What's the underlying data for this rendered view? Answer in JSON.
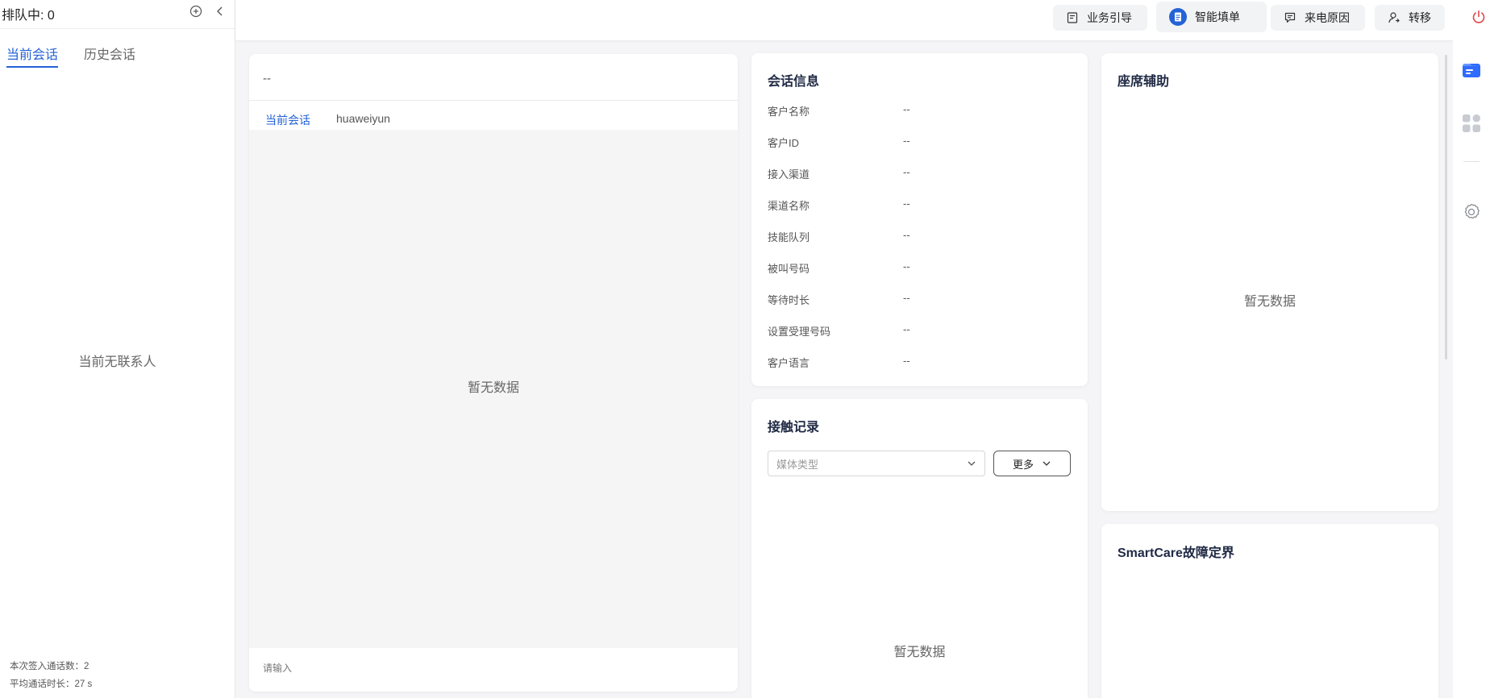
{
  "sidebar": {
    "queue_label": "排队中: 0",
    "tabs": [
      {
        "label": "当前会话",
        "active": true
      },
      {
        "label": "历史会话",
        "active": false
      }
    ],
    "empty_text": "当前无联系人",
    "stats": {
      "sign_in_calls": "本次签入通话数：2",
      "avg_call_duration": "平均通话时长：27 s"
    }
  },
  "topbar": {
    "buttons": [
      {
        "label": "业务引导",
        "icon": "guide-icon"
      },
      {
        "label": "智能填单",
        "icon": "smart-form-icon"
      },
      {
        "label": "来电原因",
        "icon": "call-reason-icon"
      },
      {
        "label": "转移",
        "icon": "transfer-icon"
      }
    ],
    "power_icon": "power-icon"
  },
  "chat": {
    "title": "--",
    "tabs": [
      {
        "label": "当前会话",
        "active": true
      },
      {
        "label": "huaweiyun",
        "active": false
      }
    ],
    "empty_text": "暂无数据",
    "input_placeholder": "请输入"
  },
  "session_info": {
    "title": "会话信息",
    "rows": [
      {
        "label": "客户名称",
        "value": "--"
      },
      {
        "label": "客户ID",
        "value": "--"
      },
      {
        "label": "接入渠道",
        "value": "--"
      },
      {
        "label": "渠道名称",
        "value": "--"
      },
      {
        "label": "技能队列",
        "value": "--"
      },
      {
        "label": "被叫号码",
        "value": "--"
      },
      {
        "label": "等待时长",
        "value": "--"
      },
      {
        "label": "设置受理号码",
        "value": "--"
      },
      {
        "label": "客户语言",
        "value": "--"
      }
    ]
  },
  "contact_record": {
    "title": "接触记录",
    "media_type_placeholder": "媒体类型",
    "more_label": "更多",
    "empty_text": "暂无数据"
  },
  "agent_assist": {
    "title": "座席辅助",
    "empty_text": "暂无数据"
  },
  "smartcare": {
    "title": "SmartCare故障定界"
  },
  "colors": {
    "accent": "#2462d6",
    "power": "#e0484b"
  }
}
